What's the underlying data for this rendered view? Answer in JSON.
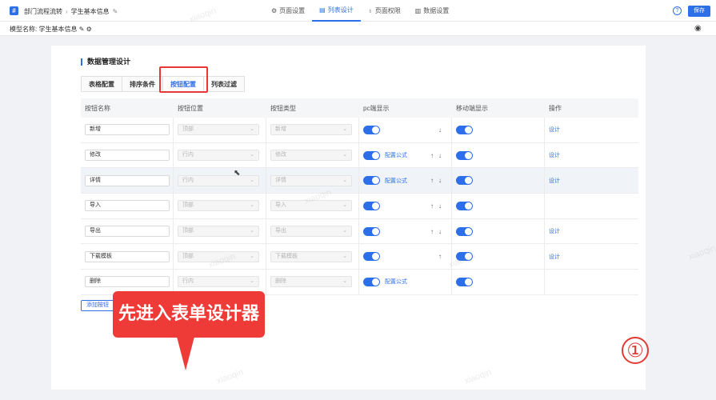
{
  "header": {
    "logo_glyph": "#",
    "breadcrumb": [
      "部门流程流转",
      "学生基本信息"
    ],
    "nav": [
      {
        "label": "页面设置",
        "icon": "gear-icon",
        "glyph": "⚙",
        "active": false
      },
      {
        "label": "列表设计",
        "icon": "list-icon",
        "glyph": "▤",
        "active": true
      },
      {
        "label": "页面权限",
        "icon": "lock-icon",
        "glyph": "♁",
        "active": false
      },
      {
        "label": "数据设置",
        "icon": "bar-chart-icon",
        "glyph": "▥",
        "active": false
      }
    ],
    "help_glyph": "?",
    "save_label": "保存"
  },
  "subheader": {
    "model_label": "模型名称: 学生基本信息"
  },
  "card": {
    "title": "数据管理设计",
    "tabs": [
      {
        "label": "表格配置",
        "active": false
      },
      {
        "label": "排序条件",
        "active": false
      },
      {
        "label": "按钮配置",
        "active": true
      },
      {
        "label": "列表过滤",
        "active": false
      }
    ],
    "columns": [
      "按钮名称",
      "按钮位置",
      "按钮类型",
      "pc端显示",
      "移动端显示",
      "操作"
    ],
    "rows": [
      {
        "name": "新增",
        "position": "顶部",
        "type": "新增",
        "formula": "",
        "arrows": [
          "↓"
        ],
        "action": "设计"
      },
      {
        "name": "修改",
        "position": "行内",
        "type": "修改",
        "formula": "配置公式",
        "arrows": [
          "↑",
          "↓"
        ],
        "action": "设计"
      },
      {
        "name": "详情",
        "position": "行内",
        "type": "详情",
        "formula": "配置公式",
        "arrows": [
          "↑",
          "↓"
        ],
        "action": "设计"
      },
      {
        "name": "导入",
        "position": "顶部",
        "type": "导入",
        "formula": "",
        "arrows": [
          "↑",
          "↓"
        ],
        "action": ""
      },
      {
        "name": "导出",
        "position": "顶部",
        "type": "导出",
        "formula": "",
        "arrows": [
          "↑",
          "↓"
        ],
        "action": "设计"
      },
      {
        "name": "下载模板",
        "position": "顶部",
        "type": "下载模板",
        "formula": "",
        "arrows": [
          "↑"
        ],
        "action": "设计"
      },
      {
        "name": "删除",
        "position": "行内",
        "type": "删除",
        "formula": "配置公式",
        "arrows": [],
        "action": ""
      }
    ],
    "add_button": "添加按钮"
  },
  "annotation": {
    "callout": "先进入表单设计器",
    "step": "①"
  },
  "colors": {
    "accent": "#2d6fe8",
    "callout": "#ef3b38"
  }
}
